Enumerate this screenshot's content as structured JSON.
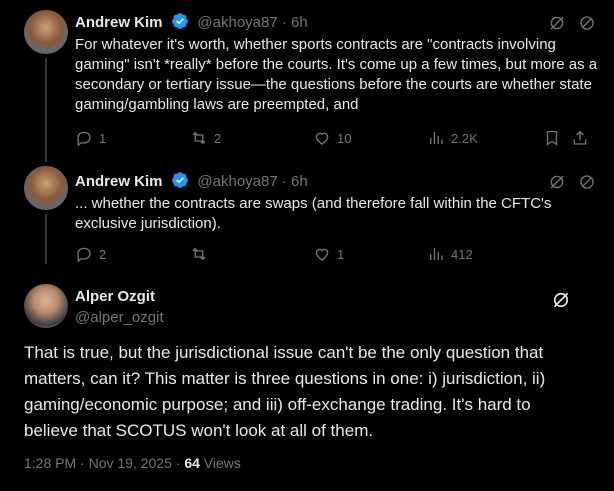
{
  "tweets": [
    {
      "name": "Andrew Kim",
      "handle": "@akhoya87 · 6h",
      "text": "For whatever it's worth, whether sports contracts are \"contracts involving gaming\" isn't *really* before the courts.  It's come up a few times, but more as a secondary or tertiary issue—the questions before the courts are whether state gaming/gambling laws are preempted, and",
      "replies": "1",
      "reposts": "2",
      "likes": "10",
      "views": "2.2K"
    },
    {
      "name": "Andrew Kim",
      "handle": "@akhoya87 · 6h",
      "text": "... whether the contracts are swaps (and therefore fall within the CFTC's exclusive jurisdiction).",
      "replies": "2",
      "reposts": "",
      "likes": "1",
      "views": "412"
    }
  ],
  "main": {
    "name": "Alper Ozgit",
    "handle": "@alper_ozgit",
    "text": "That is true, but the jurisdictional issue can't be the only question that matters, can it? This matter is three questions in one: i) jurisdiction, ii) gaming/economic purpose; and iii) off-exchange trading. It's hard to believe that SCOTUS won't look at all of them.",
    "time": "1:28 PM · Nov 19, 2025 · ",
    "views_count": "64",
    "views_label": " Views"
  },
  "colors": {
    "background": "#000000",
    "text": "#e7e9ea",
    "muted": "#71767b",
    "verified": "#1d9bf0"
  }
}
